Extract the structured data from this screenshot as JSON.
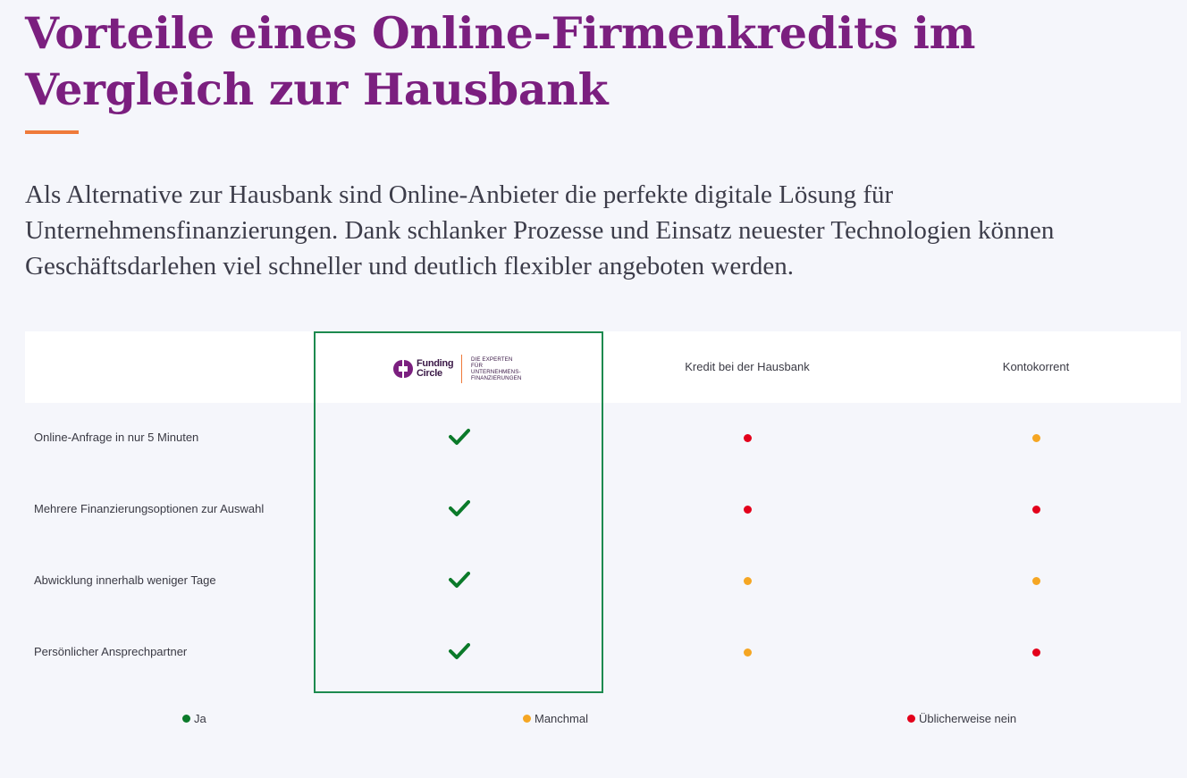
{
  "header": {
    "title": "Vorteile eines Online-Firmenkredits im Vergleich zur Hausbank",
    "intro": "Als Alternative zur Hausbank sind Online-Anbieter die perfekte digitale Lösung für Unternehmensfinanzierungen. Dank schlanker Prozesse und Einsatz neuester Technologien können Geschäftsdarlehen viel schneller und deutlich flexibler angeboten werden."
  },
  "table": {
    "logo": {
      "name": "Funding Circle",
      "tagline": "Die Experten für Unternehmens-finanzierungen",
      "icon": "funding-circle-logo-icon"
    },
    "columns": [
      "Kredit bei der Hausbank",
      "Kontokorrent"
    ],
    "rows": [
      {
        "label": "Online-Anfrage in nur 5 Minuten",
        "funding_circle": "ja",
        "hausbank": "nein",
        "kontokorrent": "manchmal"
      },
      {
        "label": "Mehrere Finanzierungsoptionen zur Auswahl",
        "funding_circle": "ja",
        "hausbank": "nein",
        "kontokorrent": "nein"
      },
      {
        "label": "Abwicklung innerhalb weniger Tage",
        "funding_circle": "ja",
        "hausbank": "manchmal",
        "kontokorrent": "manchmal"
      },
      {
        "label": "Persönlicher Ansprechpartner",
        "funding_circle": "ja",
        "hausbank": "manchmal",
        "kontokorrent": "nein"
      }
    ]
  },
  "legend": {
    "ja": "Ja",
    "manchmal": "Manchmal",
    "nein": "Üblicherweise nein"
  },
  "colors": {
    "title": "#7b1f7f",
    "accent": "#ef7a3a",
    "highlight_border": "#1d8a4f",
    "ja": "#0b7a2a",
    "manchmal": "#f5a623",
    "nein": "#e3001b"
  }
}
